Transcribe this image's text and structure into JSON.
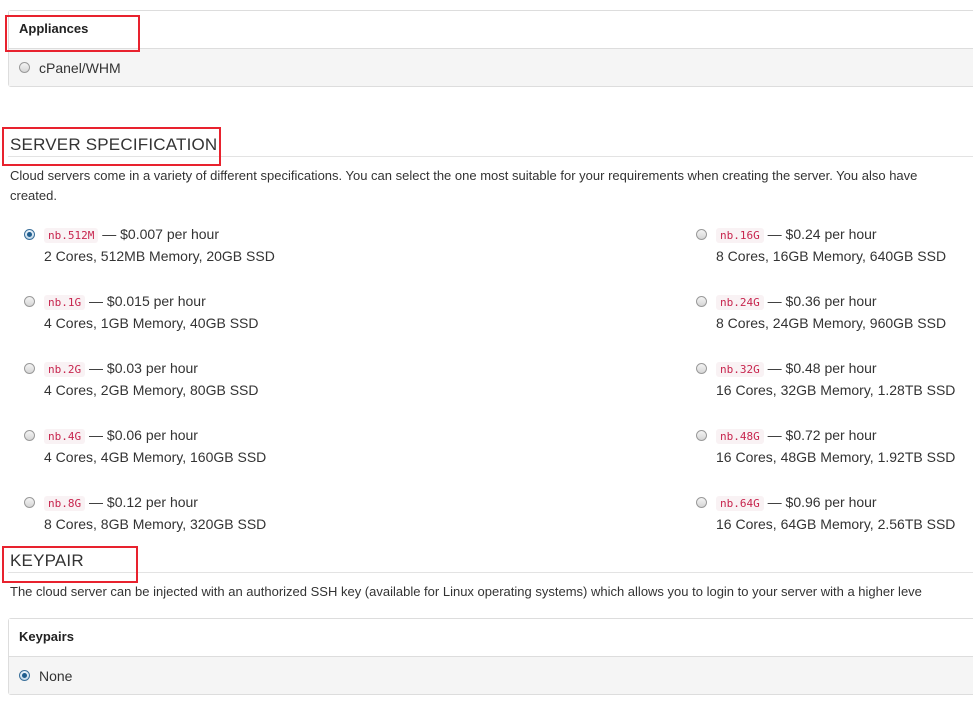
{
  "appliances": {
    "heading": "Appliances",
    "option": "cPanel/WHM"
  },
  "server_spec": {
    "title": "SERVER SPECIFICATION",
    "description_line1": "Cloud servers come in a variety of different specifications. You can select the one most suitable for your requirements when creating the server. You also have",
    "description_line2": "created.",
    "options": [
      {
        "code": "nb.512M",
        "price": " — $0.007 per hour",
        "specs": "2 Cores, 512MB Memory, 20GB SSD",
        "selected": true
      },
      {
        "code": "nb.1G",
        "price": " — $0.015 per hour",
        "specs": "4 Cores, 1GB Memory, 40GB SSD",
        "selected": false
      },
      {
        "code": "nb.2G",
        "price": " — $0.03 per hour",
        "specs": "4 Cores, 2GB Memory, 80GB SSD",
        "selected": false
      },
      {
        "code": "nb.4G",
        "price": " — $0.06 per hour",
        "specs": "4 Cores, 4GB Memory, 160GB SSD",
        "selected": false
      },
      {
        "code": "nb.8G",
        "price": " — $0.12 per hour",
        "specs": "8 Cores, 8GB Memory, 320GB SSD",
        "selected": false
      },
      {
        "code": "nb.16G",
        "price": " — $0.24 per hour",
        "specs": "8 Cores, 16GB Memory, 640GB SSD",
        "selected": false
      },
      {
        "code": "nb.24G",
        "price": " — $0.36 per hour",
        "specs": "8 Cores, 24GB Memory, 960GB SSD",
        "selected": false
      },
      {
        "code": "nb.32G",
        "price": " — $0.48 per hour",
        "specs": "16 Cores, 32GB Memory, 1.28TB SSD",
        "selected": false
      },
      {
        "code": "nb.48G",
        "price": " — $0.72 per hour",
        "specs": "16 Cores, 48GB Memory, 1.92TB SSD",
        "selected": false
      },
      {
        "code": "nb.64G",
        "price": " — $0.96 per hour",
        "specs": "16 Cores, 64GB Memory, 2.56TB SSD",
        "selected": false
      }
    ]
  },
  "keypair": {
    "title": "KEYPAIR",
    "description": "The cloud server can be injected with an authorized SSH key (available for Linux operating systems) which allows you to login to your server with a higher leve",
    "heading": "Keypairs",
    "option": "None",
    "option_selected": true
  },
  "colors": {
    "annotation_box": "#e8222e",
    "code_text": "#c7254e",
    "code_bg": "#f9f2f4"
  }
}
